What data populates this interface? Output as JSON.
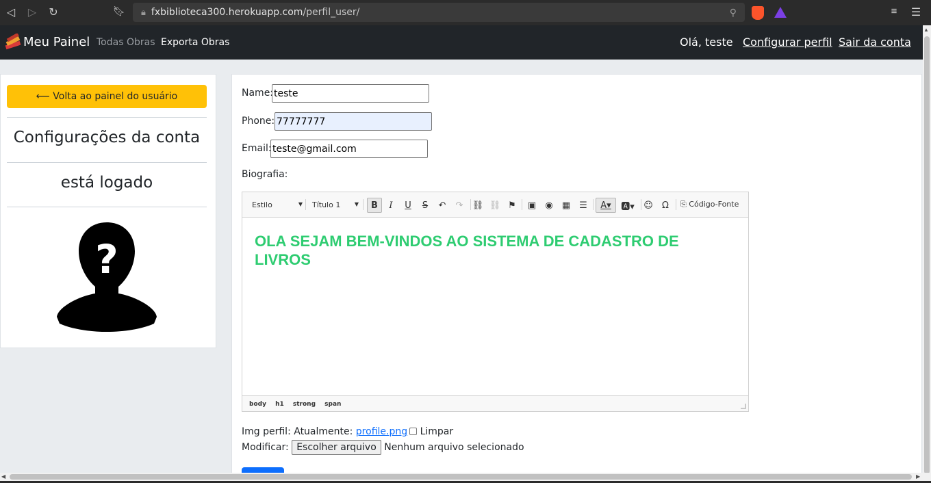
{
  "browser": {
    "url_host": "fxbiblioteca300.herokuapp.com",
    "url_path": "/perfil_user/"
  },
  "navbar": {
    "brand": "Meu Painel",
    "links": [
      "Todas Obras",
      "Exporta Obras"
    ],
    "greeting": "Olá,  teste",
    "configure": "Configurar perfil",
    "logout": "Sair da conta"
  },
  "sidebar": {
    "back_button": "⟵ Volta ao painel do usuário",
    "heading": "Configurações da conta",
    "status": "está logado",
    "avatar_icon": "unknown-user-icon"
  },
  "form": {
    "name_label": "Name:",
    "name_value": "teste",
    "phone_label": "Phone:",
    "phone_value": "77777777",
    "email_label": "Email:",
    "email_value": "teste@gmail.com",
    "bio_label": "Biografia:"
  },
  "editor": {
    "style_combo": "Estilo",
    "format_combo": "Título 1",
    "source_label": "Código-Fonte",
    "content": "OLA SEJAM BEM-VINDOS AO SISTEMA DE CADASTRO DE LIVROS",
    "path": [
      "body",
      "h1",
      "strong",
      "span"
    ],
    "content_color": "#2ecc71"
  },
  "image": {
    "label": "Img perfil: Atualmente:",
    "current_file": "profile.png",
    "clear_label": "Limpar",
    "modify_label": "Modificar:",
    "choose_button": "Escolher arquivo",
    "no_file": "Nenhum arquivo selecionado"
  },
  "colors": {
    "navbar_bg": "#212529",
    "back_button_bg": "#ffc107",
    "primary": "#0d6efd"
  }
}
